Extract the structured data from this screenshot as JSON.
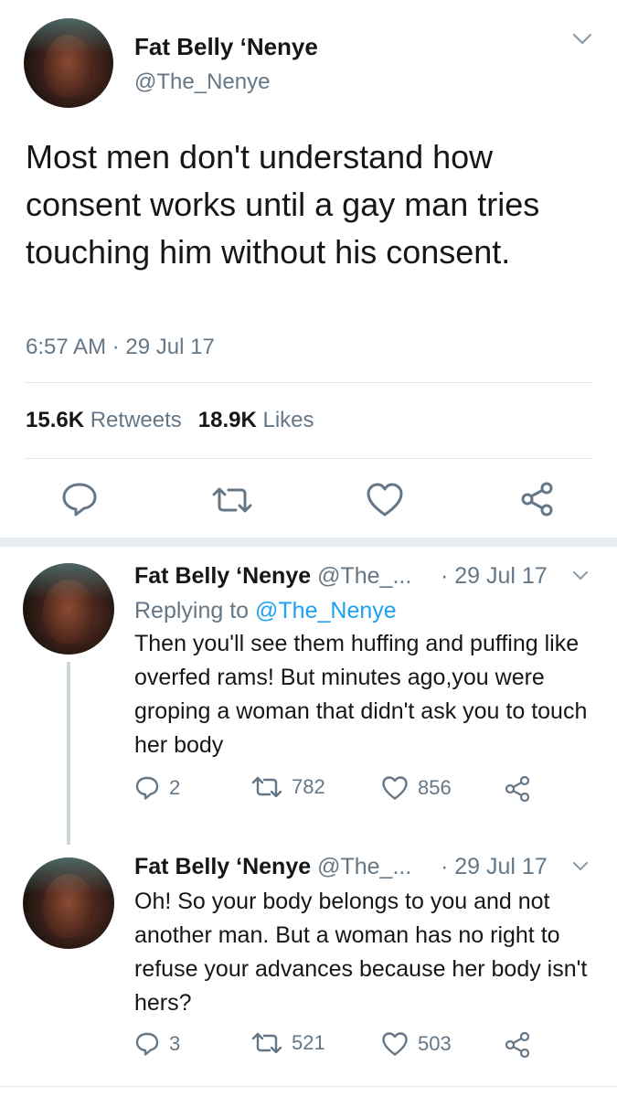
{
  "main_tweet": {
    "author_name": "Fat Belly ‘Nenye",
    "author_handle": "@The_Nenye",
    "text": "Most men don't understand how consent works until a gay man tries touching him without his consent.",
    "timestamp": "6:57 AM · 29 Jul 17",
    "retweets_count": "15.6K",
    "retweets_label": "Retweets",
    "likes_count": "18.9K",
    "likes_label": "Likes",
    "actions": [
      "reply-icon",
      "retweet-icon",
      "like-icon",
      "share-icon"
    ]
  },
  "replies": [
    {
      "author_name": "Fat Belly ‘Nenye",
      "author_handle": "@The_...",
      "date": "· 29 Jul 17",
      "replying_prefix": "Replying to",
      "replying_to": "@The_Nenye",
      "text": "Then you'll see them huffing and puffing like overfed rams! But minutes ago,you were groping a woman that didn't ask you to touch her body",
      "reply_count": "2",
      "retweet_count": "782",
      "like_count": "856"
    },
    {
      "author_name": "Fat Belly ‘Nenye",
      "author_handle": "@The_...",
      "date": "· 29 Jul 17",
      "text": "Oh! So your body belongs to you and not another man. But a woman has no right to refuse your advances because her body isn't hers?",
      "reply_count": "3",
      "retweet_count": "521",
      "like_count": "503"
    }
  ],
  "colors": {
    "text": "#14171a",
    "muted": "#657786",
    "link": "#1da1f2",
    "divider": "#e1e8ed"
  }
}
